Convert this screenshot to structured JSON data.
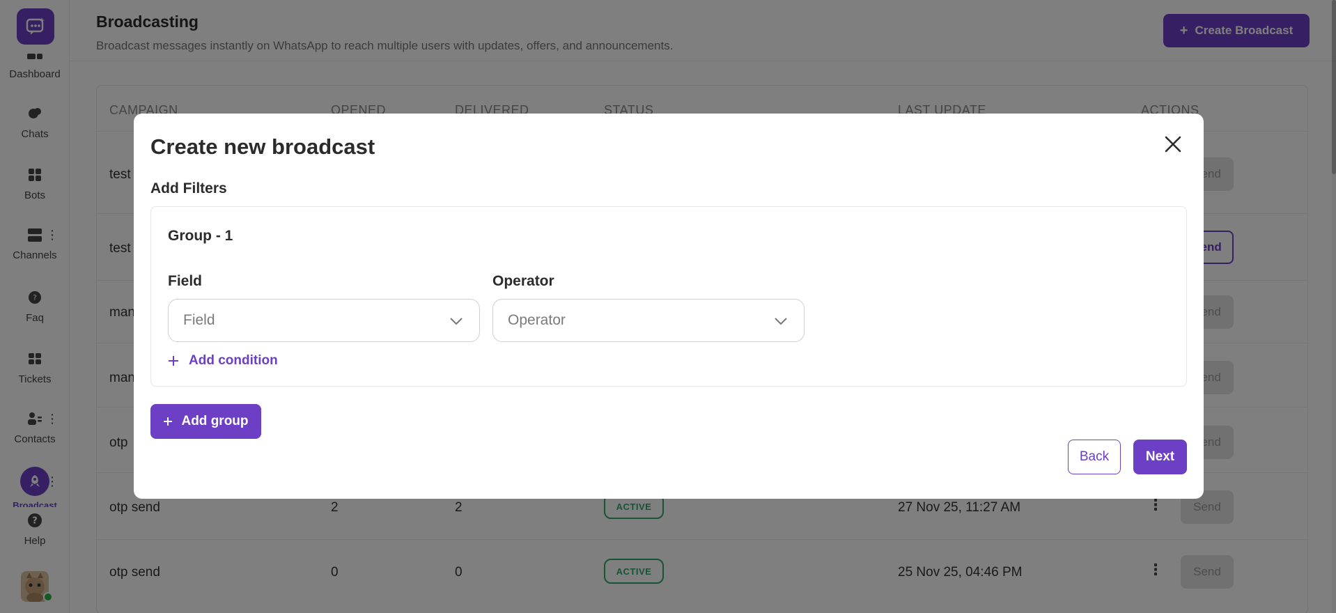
{
  "sidebar": {
    "items": [
      {
        "label": "Dashboard",
        "icon": "dashboard-icon"
      },
      {
        "label": "Chats",
        "icon": "chat-icon"
      },
      {
        "label": "Bots",
        "icon": "bot-icon"
      },
      {
        "label": "Channels",
        "icon": "channels-icon"
      },
      {
        "label": "Faq",
        "icon": "faq-icon"
      },
      {
        "label": "Tickets",
        "icon": "ticket-icon"
      },
      {
        "label": "Contacts",
        "icon": "contacts-icon"
      },
      {
        "label": "Broadcast",
        "icon": "rocket-icon"
      },
      {
        "label": "Help",
        "icon": "help-icon"
      }
    ]
  },
  "header": {
    "title": "Broadcasting",
    "subtitle": "Broadcast messages instantly on WhatsApp to reach multiple users with updates, offers, and announcements.",
    "create_label": "Create Broadcast"
  },
  "table": {
    "headers": [
      "CAMPAIGN",
      "OPENED",
      "DELIVERED",
      "STATUS",
      "LAST UPDATE",
      "ACTIONS"
    ],
    "rows": [
      {
        "campaign": "test",
        "opened": "",
        "delivered": "",
        "status": "",
        "last_update": "",
        "send": "Send"
      },
      {
        "campaign": "test",
        "opened": "",
        "delivered": "",
        "status": "",
        "last_update": "",
        "send": "Send"
      },
      {
        "campaign": "man",
        "opened": "",
        "delivered": "",
        "status": "",
        "last_update": "",
        "send": "Send"
      },
      {
        "campaign": "man",
        "opened": "",
        "delivered": "",
        "status": "",
        "last_update": "",
        "send": "Send"
      },
      {
        "campaign": "otp",
        "opened": "",
        "delivered": "",
        "status": "",
        "last_update": "",
        "send": "Send"
      },
      {
        "campaign": "otp send",
        "opened": "2",
        "delivered": "2",
        "status": "ACTIVE",
        "last_update": "27 Nov 25, 11:27 AM",
        "send": "Send"
      },
      {
        "campaign": "otp send",
        "opened": "0",
        "delivered": "0",
        "status": "ACTIVE",
        "last_update": "25 Nov 25, 04:46 PM",
        "send": "Send"
      }
    ]
  },
  "modal": {
    "title": "Create new broadcast",
    "section_label": "Add Filters",
    "group_title": "Group - 1",
    "field_label": "Field",
    "field_placeholder": "Field",
    "operator_label": "Operator",
    "operator_placeholder": "Operator",
    "add_condition_label": "Add condition",
    "add_group_label": "Add group",
    "back_label": "Back",
    "next_label": "Next"
  },
  "colors": {
    "accent": "#6c3fc4",
    "status_active": "#2fa66a"
  }
}
